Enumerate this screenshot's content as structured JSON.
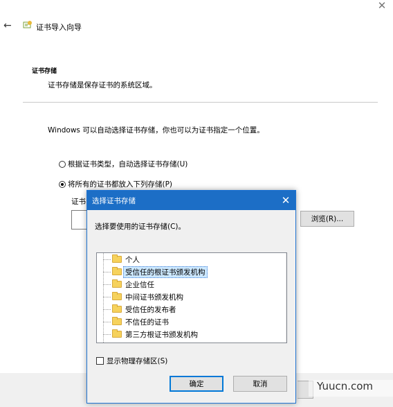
{
  "window": {
    "title": "证书导入向导",
    "close_glyph": "✕",
    "back_glyph": "←"
  },
  "section": {
    "heading": "证书存储",
    "description": "证书存储是保存证书的系统区域。"
  },
  "intro": "Windows 可以自动选择证书存储，你也可以为证书指定一个位置。",
  "options": {
    "auto": "根据证书类型，自动选择证书存储(U)",
    "manual": "将所有的证书都放入下列存储(P)",
    "selected": "manual"
  },
  "store_label": "证书",
  "browse_label": "浏览(R)...",
  "dialog": {
    "title": "选择证书存储",
    "close_glyph": "✕",
    "prompt": "选择要使用的证书存储(C)。",
    "tree_items": [
      "个人",
      "受信任的根证书颁发机构",
      "企业信任",
      "中间证书颁发机构",
      "受信任的发布者",
      "不信任的证书",
      "第三方根证书颁发机构"
    ],
    "selected_item": "受信任的根证书颁发机构",
    "show_physical_label": "显示物理存储区(S)",
    "ok_label": "确定",
    "cancel_label": "取消"
  },
  "watermark": "Yuucn.com",
  "colors": {
    "titlebar": "#1c6ec6",
    "selection": "#cce8ff",
    "folder": "#f6d25c"
  }
}
